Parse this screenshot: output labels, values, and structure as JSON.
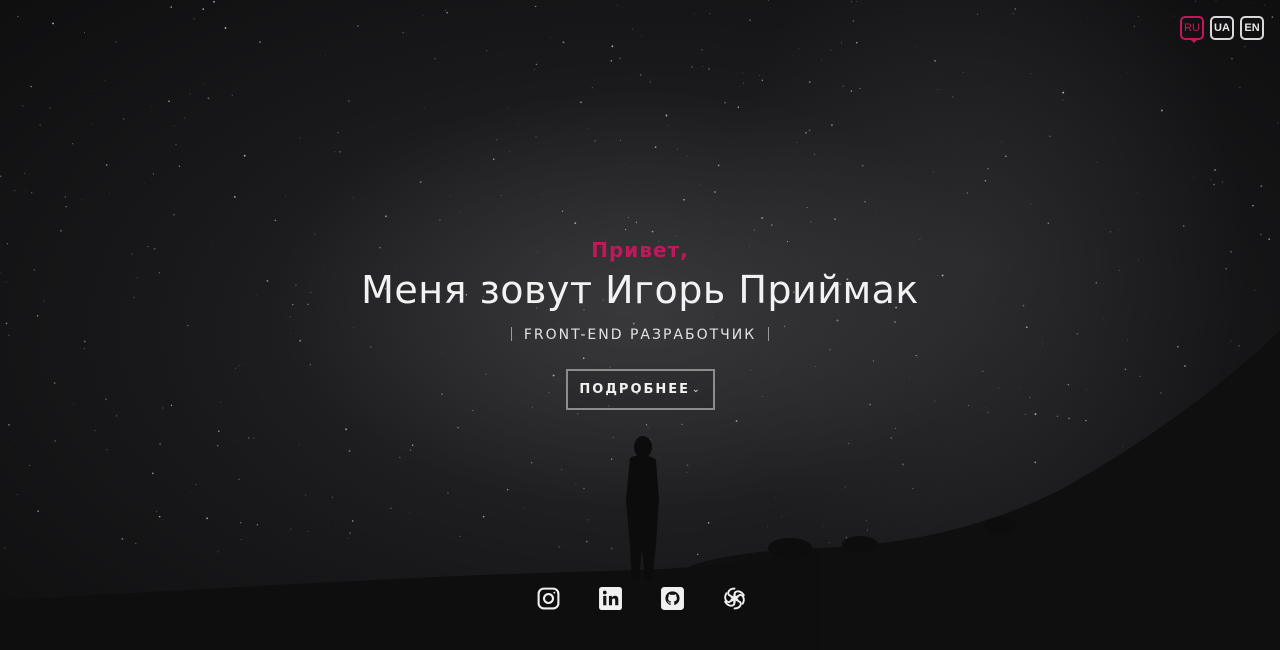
{
  "language_switcher": {
    "items": [
      {
        "label": "RU",
        "active": true
      },
      {
        "label": "UA",
        "active": false
      },
      {
        "label": "EN",
        "active": false
      }
    ]
  },
  "hero": {
    "greeting": "Привет,",
    "name": "Меня зовут Игорь Приймак",
    "role": "FRONT-END РАЗРАБОТЧИК",
    "more_button_label": "ПОДРОБНЕЕ"
  },
  "socials": [
    {
      "icon": "instagram-icon"
    },
    {
      "icon": "linkedin-icon"
    },
    {
      "icon": "github-icon"
    },
    {
      "icon": "codepen-icon"
    }
  ],
  "colors": {
    "accent": "#c2185b",
    "text": "#f2f2f2",
    "background": "#0d0d0e"
  }
}
